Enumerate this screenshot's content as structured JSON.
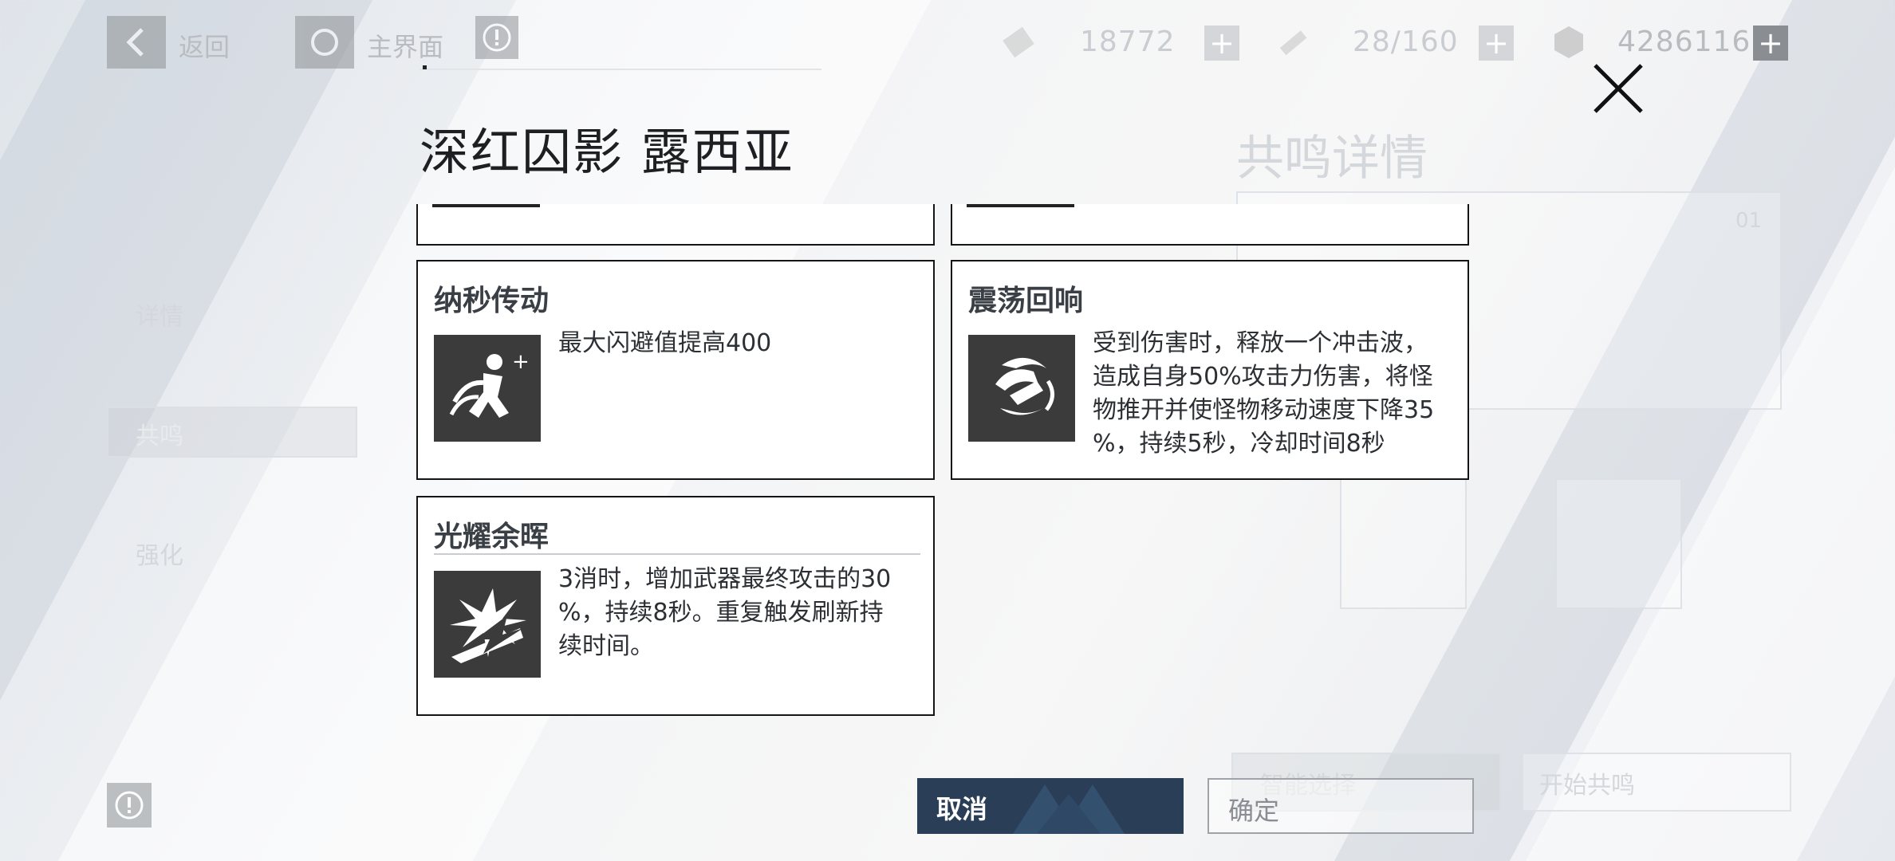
{
  "topbar": {
    "back_label": "返回",
    "home_label": "主界面",
    "currency1": "18772",
    "stamina": "28/160",
    "gold": "4286116"
  },
  "background_page": {
    "title": "共鸣详情",
    "side_tab_details": "详情",
    "side_tab_resonance": "共鸣",
    "side_tab_enhance": "强化",
    "slot_number": "01",
    "auto_select": "智能选择",
    "start_resonance": "开始共鸣"
  },
  "modal": {
    "title": "深红囚影 露西亚",
    "cards": [
      {
        "name": "纳秒传动",
        "icon": "dodge-runner-icon",
        "desc_lines": [
          "最大闪避值提高400"
        ]
      },
      {
        "name": "震荡回响",
        "icon": "shockwave-icon",
        "desc_lines": [
          "受到伤害时，释放一个冲击波，",
          "造成自身50%攻击力伤害，将怪",
          "物推开并使怪物移动速度下降35",
          "%，持续5秒，冷却时间8秒"
        ]
      },
      {
        "name": "光耀余晖",
        "icon": "burst-strike-icon",
        "desc_lines": [
          "3消时，增加武器最终攻击的30",
          "%，持续8秒。重复触发刷新持",
          "续时间。"
        ]
      }
    ],
    "cancel_label": "取消",
    "confirm_label": "确定"
  },
  "colors": {
    "accent": "#2a3e57",
    "card_border": "#151515",
    "icon_bg": "#3b3b3b"
  }
}
